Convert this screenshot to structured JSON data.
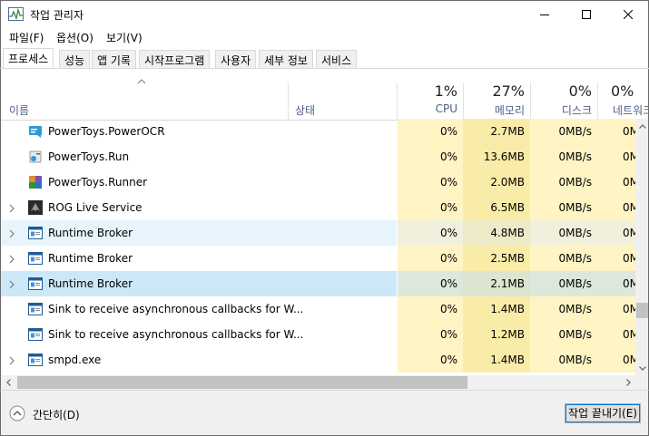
{
  "window": {
    "title": "작업 관리자",
    "app_icon": "task-manager-icon"
  },
  "menu": {
    "items": [
      "파일(F)",
      "옵션(O)",
      "보기(V)"
    ]
  },
  "tabs": [
    {
      "label": "프로세스",
      "active": true
    },
    {
      "label": "성능"
    },
    {
      "label": "앱 기록"
    },
    {
      "label": "시작프로그램"
    },
    {
      "label": "사용자"
    },
    {
      "label": "세부 정보"
    },
    {
      "label": "서비스"
    }
  ],
  "columns": {
    "name": "이름",
    "status": "상태",
    "cpu": {
      "pct": "1%",
      "label": "CPU"
    },
    "memory": {
      "pct": "27%",
      "label": "메모리"
    },
    "disk": {
      "pct": "0%",
      "label": "디스크"
    },
    "network": {
      "pct": "0%",
      "label": "네트워크"
    }
  },
  "rows": [
    {
      "name": "PowerToys.PowerOCR",
      "icon": "powertoys-ocr-icon",
      "expandable": false,
      "cpu": "0%",
      "memory": "2.7MB",
      "disk": "0MB/s",
      "network": "0Mbps"
    },
    {
      "name": "PowerToys.Run",
      "icon": "powertoys-run-icon",
      "expandable": false,
      "cpu": "0%",
      "memory": "13.6MB",
      "disk": "0MB/s",
      "network": "0Mbps"
    },
    {
      "name": "PowerToys.Runner",
      "icon": "powertoys-runner-icon",
      "expandable": false,
      "cpu": "0%",
      "memory": "2.0MB",
      "disk": "0MB/s",
      "network": "0Mbps"
    },
    {
      "name": "ROG Live Service",
      "icon": "rog-icon",
      "expandable": true,
      "cpu": "0%",
      "memory": "6.5MB",
      "disk": "0MB/s",
      "network": "0Mbps"
    },
    {
      "name": "Runtime Broker",
      "icon": "window-app-icon",
      "expandable": true,
      "state": "hover",
      "cpu": "0%",
      "memory": "4.8MB",
      "disk": "0MB/s",
      "network": "0Mbps"
    },
    {
      "name": "Runtime Broker",
      "icon": "window-app-icon",
      "expandable": true,
      "cpu": "0%",
      "memory": "2.5MB",
      "disk": "0MB/s",
      "network": "0Mbps"
    },
    {
      "name": "Runtime Broker",
      "icon": "window-app-icon",
      "expandable": true,
      "state": "selected",
      "cpu": "0%",
      "memory": "2.1MB",
      "disk": "0MB/s",
      "network": "0Mbps"
    },
    {
      "name": "Sink to receive asynchronous callbacks for W...",
      "icon": "window-app-icon",
      "expandable": false,
      "cpu": "0%",
      "memory": "1.4MB",
      "disk": "0MB/s",
      "network": "0Mbps"
    },
    {
      "name": "Sink to receive asynchronous callbacks for W...",
      "icon": "window-app-icon",
      "expandable": false,
      "cpu": "0%",
      "memory": "1.2MB",
      "disk": "0MB/s",
      "network": "0Mbps"
    },
    {
      "name": "smpd.exe",
      "icon": "window-app-icon",
      "expandable": true,
      "cpu": "0%",
      "memory": "1.4MB",
      "disk": "0MB/s",
      "network": "0Mbps"
    }
  ],
  "footer": {
    "fewer_details": "간단히(D)",
    "end_task": "작업 끝내기(E)"
  },
  "colors": {
    "cpu_bg": "#fff4c4",
    "memory_bg": "#f9eca8",
    "selected_bg": "#cce8f7",
    "hover_bg": "#e8f4fb",
    "header_label": "#4d6082"
  }
}
